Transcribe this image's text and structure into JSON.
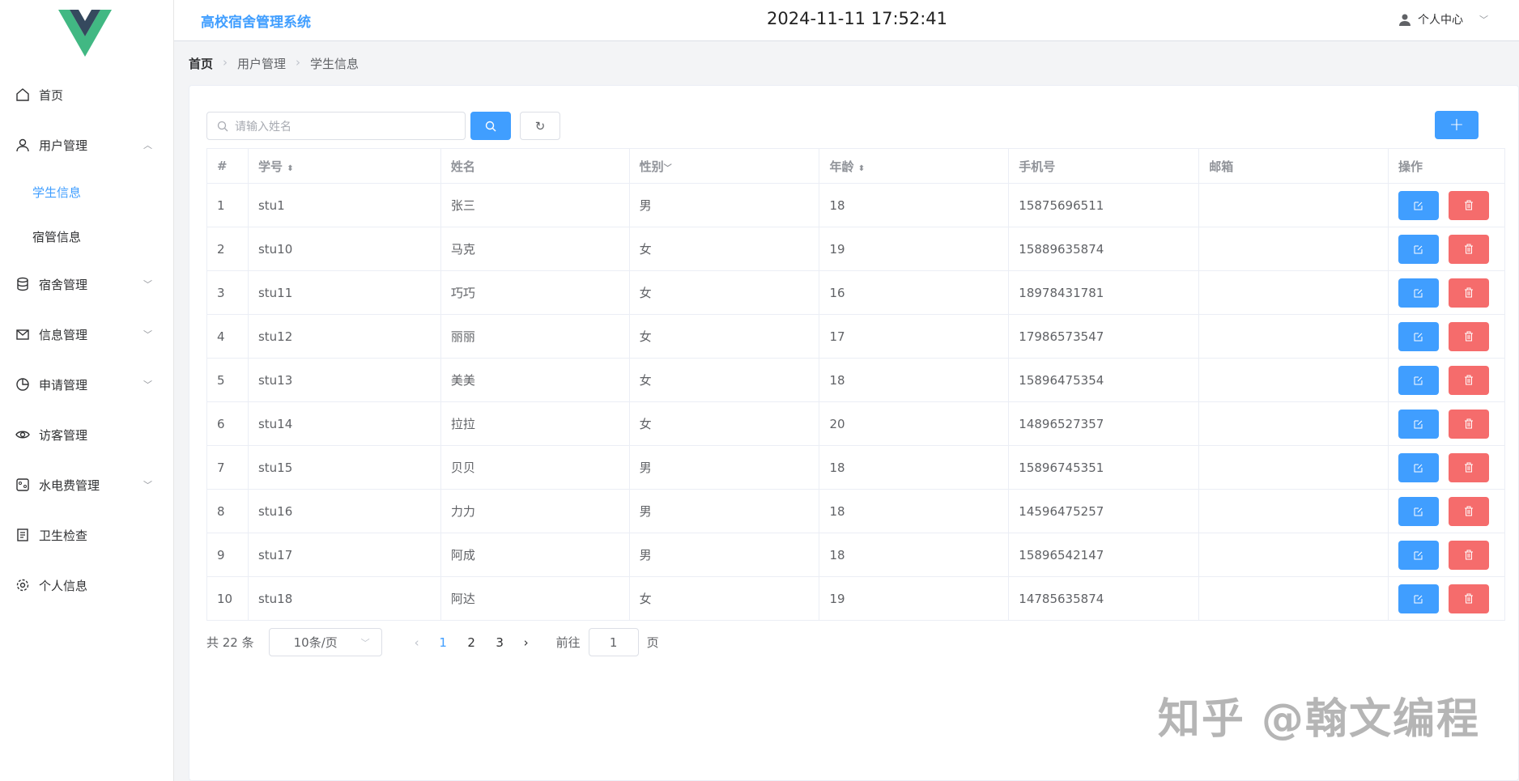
{
  "header": {
    "title": "高校宿舍管理系统",
    "datetime": "2024-11-11 17:52:41",
    "user_menu": "个人中心"
  },
  "sidebar": {
    "items": [
      {
        "label": "首页",
        "icon": "home-icon"
      },
      {
        "label": "用户管理",
        "icon": "user-icon",
        "expanded": true,
        "children": [
          {
            "label": "学生信息",
            "active": true
          },
          {
            "label": "宿管信息"
          }
        ]
      },
      {
        "label": "宿舍管理",
        "icon": "database-icon"
      },
      {
        "label": "信息管理",
        "icon": "message-icon"
      },
      {
        "label": "申请管理",
        "icon": "pie-chart-icon"
      },
      {
        "label": "访客管理",
        "icon": "eye-icon"
      },
      {
        "label": "水电费管理",
        "icon": "utilities-icon"
      },
      {
        "label": "卫生检查",
        "icon": "document-icon"
      },
      {
        "label": "个人信息",
        "icon": "gear-icon"
      }
    ]
  },
  "breadcrumb": [
    "首页",
    "用户管理",
    "学生信息"
  ],
  "search": {
    "placeholder": "请输入姓名"
  },
  "table": {
    "columns": [
      "#",
      "学号",
      "姓名",
      "性别",
      "年龄",
      "手机号",
      "邮箱",
      "操作"
    ],
    "rows": [
      [
        "1",
        "stu1",
        "张三",
        "男",
        "18",
        "15875696511",
        ""
      ],
      [
        "2",
        "stu10",
        "马克",
        "女",
        "19",
        "15889635874",
        ""
      ],
      [
        "3",
        "stu11",
        "巧巧",
        "女",
        "16",
        "18978431781",
        ""
      ],
      [
        "4",
        "stu12",
        "丽丽",
        "女",
        "17",
        "17986573547",
        ""
      ],
      [
        "5",
        "stu13",
        "美美",
        "女",
        "18",
        "15896475354",
        ""
      ],
      [
        "6",
        "stu14",
        "拉拉",
        "女",
        "20",
        "14896527357",
        ""
      ],
      [
        "7",
        "stu15",
        "贝贝",
        "男",
        "18",
        "15896745351",
        ""
      ],
      [
        "8",
        "stu16",
        "力力",
        "男",
        "18",
        "14596475257",
        ""
      ],
      [
        "9",
        "stu17",
        "阿成",
        "男",
        "18",
        "15896542147",
        ""
      ],
      [
        "10",
        "stu18",
        "阿达",
        "女",
        "19",
        "14785635874",
        ""
      ]
    ]
  },
  "pagination": {
    "total": "共 22 条",
    "page_size": "10条/页",
    "pages": [
      "1",
      "2",
      "3"
    ],
    "current": "1",
    "goto_label": "前往",
    "goto_value": "1",
    "page_suffix": "页"
  },
  "watermark": "知乎 @翰文编程",
  "colors": {
    "primary": "#409eff",
    "danger": "#f56c6c",
    "logo_green": "#41b883",
    "logo_dark": "#35495e"
  }
}
